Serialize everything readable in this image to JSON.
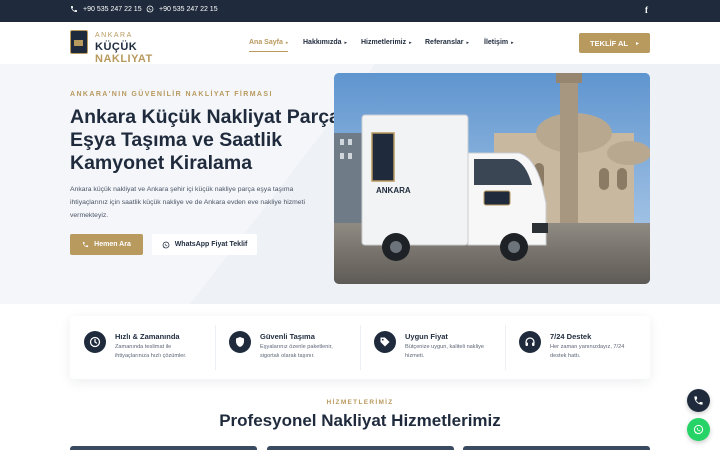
{
  "colors": {
    "navy": "#1f2b3d",
    "gold": "#b8995e",
    "whatsapp_green": "#25d366"
  },
  "topbar": {
    "phone1": "+90 535 247 22 15",
    "phone2": "+90 535 247 22 15",
    "phone1_icon": "phone-icon",
    "phone2_icon": "whatsapp-icon",
    "social": "f"
  },
  "header": {
    "logo": {
      "line1": "ANKARA",
      "line2_part1": "KÜÇÜK",
      "line2_part2": "NAKLIYAT"
    },
    "nav": [
      {
        "label": "Ana Sayfa",
        "active": true
      },
      {
        "label": "Hakkımızda"
      },
      {
        "label": "Hizmetlerimiz"
      },
      {
        "label": "Referanslar"
      },
      {
        "label": "İletişim"
      }
    ],
    "cta_label": "TEKLİF AL",
    "cta_icon": "caret-right-icon"
  },
  "hero": {
    "eyebrow": "ANKARA'NIN GÜVENİLİR NAKLİYAT FİRMASI",
    "title": "Ankara Küçük Nakliyat Parça Eşya Taşıma ve Saatlik Kamyonet Kiralama",
    "lead": "Ankara küçük nakliyat ve Ankara şehir içi küçük nakliye parça eşya taşıma ihtiyaçlarınız için saatlik küçük nakliye ve de Ankara evden eve nakliye hizmeti vermekteyiz.",
    "primary_button": "Hemen Ara",
    "secondary_button": "WhatsApp Fiyat Teklif",
    "truck_sign": "ANKARA"
  },
  "features": [
    {
      "title": "Hızlı & Zamanında",
      "desc": "Zamanında teslimat ile ihtiyaçlarınıza hızlı çözümler.",
      "icon": "clock-icon"
    },
    {
      "title": "Güvenli Taşıma",
      "desc": "Eşyalarınız özenle paketlenir, sigortalı olarak taşınır.",
      "icon": "shield-icon"
    },
    {
      "title": "Uygun Fiyat",
      "desc": "Bütçenize uygun, kaliteli nakliye hizmeti.",
      "icon": "tag-icon"
    },
    {
      "title": "7/24 Destek",
      "desc": "Her zaman yanınızdayız, 7/24 destek hattı.",
      "icon": "headset-icon"
    }
  ],
  "services": {
    "eyebrow": "HİZMETLERİMİZ",
    "title": "Profesyonel Nakliyat Hizmetlerimiz"
  },
  "floating": {
    "call_icon": "phone-icon",
    "whatsapp_icon": "whatsapp-icon"
  }
}
